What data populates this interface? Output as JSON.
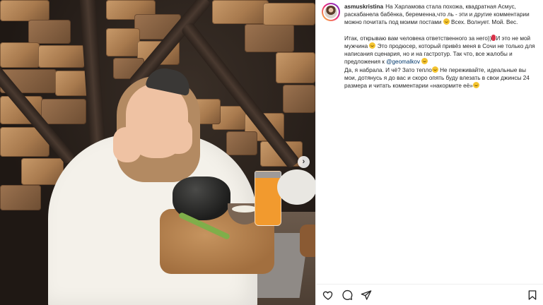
{
  "post": {
    "username": "asmuskristina",
    "caption_lines": [
      "На Харламова стала похожа, квадратная Асмус, раскабанела бабёнка, беременна,что ль - эти и другие комментарии можно почитать под моими постами ",
      " Всех. Волнует. Мой. Вес.",
      "",
      "Итак, открываю вам человека ответственного за него))",
      "И это не мой мужчина ",
      " Это продюсер, который привёз меня в Сочи не только для написания сценария, но и на гастротур. Так что, все жалобы и предложения к ",
      "@geomalkov",
      "Да, я набрала. И чё? Зато тепло",
      " Не переживайте, идеальные вы мои, дотянусь я до вас и скоро опять буду влезать в свои джинсы 24 размера и читать комментарии «накормите её»"
    ]
  },
  "icons": {
    "next": "chevron-right-icon",
    "like": "heart-icon",
    "comment": "comment-icon",
    "share": "send-icon",
    "save": "bookmark-icon"
  },
  "colors": {
    "mention": "#00376b",
    "text": "#262626"
  }
}
